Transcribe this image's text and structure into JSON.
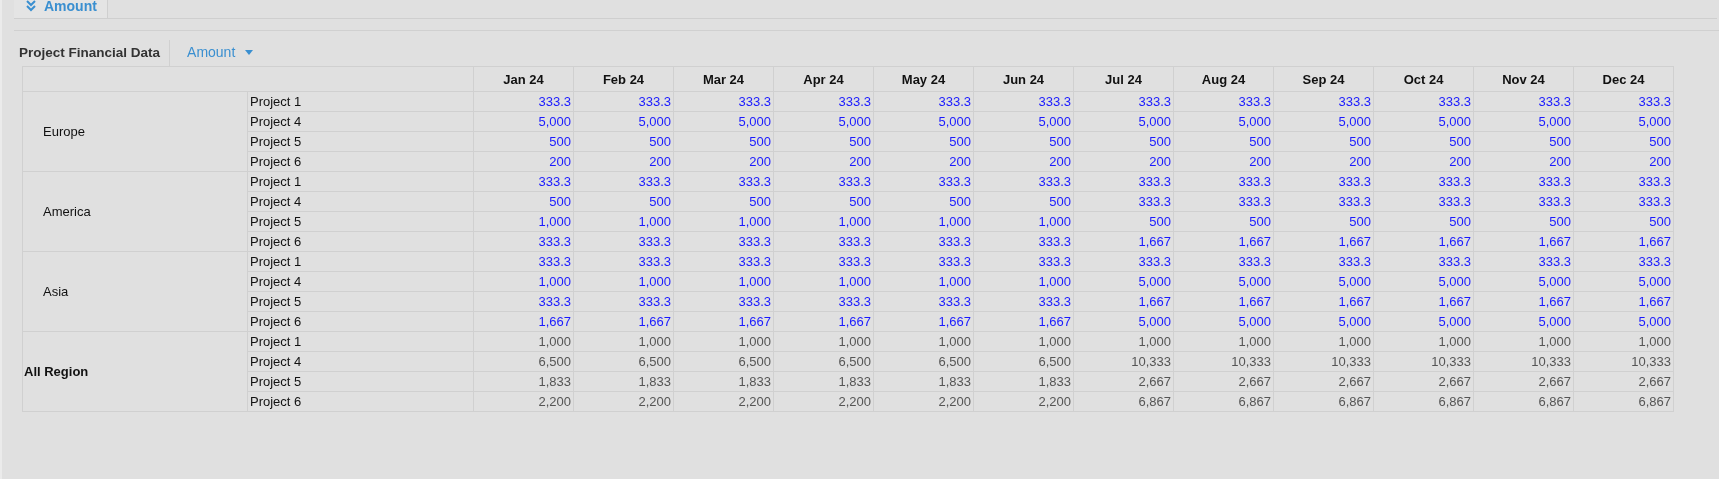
{
  "tab": {
    "label": "Amount",
    "selected": true
  },
  "toolbar": {
    "title": "Project Financial Data",
    "measure_dropdown": "Amount"
  },
  "table": {
    "columns": [
      "Jan 24",
      "Feb 24",
      "Mar 24",
      "Apr 24",
      "May 24",
      "Jun 24",
      "Jul 24",
      "Aug 24",
      "Sep 24",
      "Oct 24",
      "Nov 24",
      "Dec 24"
    ],
    "groups": [
      {
        "region": "Europe",
        "kind": "detail",
        "rows": [
          {
            "project": "Project 1",
            "values": [
              "333.3",
              "333.3",
              "333.3",
              "333.3",
              "333.3",
              "333.3",
              "333.3",
              "333.3",
              "333.3",
              "333.3",
              "333.3",
              "333.3"
            ]
          },
          {
            "project": "Project 4",
            "values": [
              "5,000",
              "5,000",
              "5,000",
              "5,000",
              "5,000",
              "5,000",
              "5,000",
              "5,000",
              "5,000",
              "5,000",
              "5,000",
              "5,000"
            ]
          },
          {
            "project": "Project 5",
            "values": [
              "500",
              "500",
              "500",
              "500",
              "500",
              "500",
              "500",
              "500",
              "500",
              "500",
              "500",
              "500"
            ]
          },
          {
            "project": "Project 6",
            "values": [
              "200",
              "200",
              "200",
              "200",
              "200",
              "200",
              "200",
              "200",
              "200",
              "200",
              "200",
              "200"
            ]
          }
        ]
      },
      {
        "region": "America",
        "kind": "detail",
        "rows": [
          {
            "project": "Project 1",
            "values": [
              "333.3",
              "333.3",
              "333.3",
              "333.3",
              "333.3",
              "333.3",
              "333.3",
              "333.3",
              "333.3",
              "333.3",
              "333.3",
              "333.3"
            ]
          },
          {
            "project": "Project 4",
            "values": [
              "500",
              "500",
              "500",
              "500",
              "500",
              "500",
              "333.3",
              "333.3",
              "333.3",
              "333.3",
              "333.3",
              "333.3"
            ]
          },
          {
            "project": "Project 5",
            "values": [
              "1,000",
              "1,000",
              "1,000",
              "1,000",
              "1,000",
              "1,000",
              "500",
              "500",
              "500",
              "500",
              "500",
              "500"
            ]
          },
          {
            "project": "Project 6",
            "values": [
              "333.3",
              "333.3",
              "333.3",
              "333.3",
              "333.3",
              "333.3",
              "1,667",
              "1,667",
              "1,667",
              "1,667",
              "1,667",
              "1,667"
            ]
          }
        ]
      },
      {
        "region": "Asia",
        "kind": "detail",
        "rows": [
          {
            "project": "Project 1",
            "values": [
              "333.3",
              "333.3",
              "333.3",
              "333.3",
              "333.3",
              "333.3",
              "333.3",
              "333.3",
              "333.3",
              "333.3",
              "333.3",
              "333.3"
            ]
          },
          {
            "project": "Project 4",
            "values": [
              "1,000",
              "1,000",
              "1,000",
              "1,000",
              "1,000",
              "1,000",
              "5,000",
              "5,000",
              "5,000",
              "5,000",
              "5,000",
              "5,000"
            ]
          },
          {
            "project": "Project 5",
            "values": [
              "333.3",
              "333.3",
              "333.3",
              "333.3",
              "333.3",
              "333.3",
              "1,667",
              "1,667",
              "1,667",
              "1,667",
              "1,667",
              "1,667"
            ]
          },
          {
            "project": "Project 6",
            "values": [
              "1,667",
              "1,667",
              "1,667",
              "1,667",
              "1,667",
              "1,667",
              "5,000",
              "5,000",
              "5,000",
              "5,000",
              "5,000",
              "5,000"
            ]
          }
        ]
      },
      {
        "region": "All Region",
        "kind": "total",
        "rows": [
          {
            "project": "Project 1",
            "values": [
              "1,000",
              "1,000",
              "1,000",
              "1,000",
              "1,000",
              "1,000",
              "1,000",
              "1,000",
              "1,000",
              "1,000",
              "1,000",
              "1,000"
            ]
          },
          {
            "project": "Project 4",
            "values": [
              "6,500",
              "6,500",
              "6,500",
              "6,500",
              "6,500",
              "6,500",
              "10,333",
              "10,333",
              "10,333",
              "10,333",
              "10,333",
              "10,333"
            ]
          },
          {
            "project": "Project 5",
            "values": [
              "1,833",
              "1,833",
              "1,833",
              "1,833",
              "1,833",
              "1,833",
              "2,667",
              "2,667",
              "2,667",
              "2,667",
              "2,667",
              "2,667"
            ]
          },
          {
            "project": "Project 6",
            "values": [
              "2,200",
              "2,200",
              "2,200",
              "2,200",
              "2,200",
              "2,200",
              "6,867",
              "6,867",
              "6,867",
              "6,867",
              "6,867",
              "6,867"
            ]
          }
        ]
      }
    ]
  }
}
